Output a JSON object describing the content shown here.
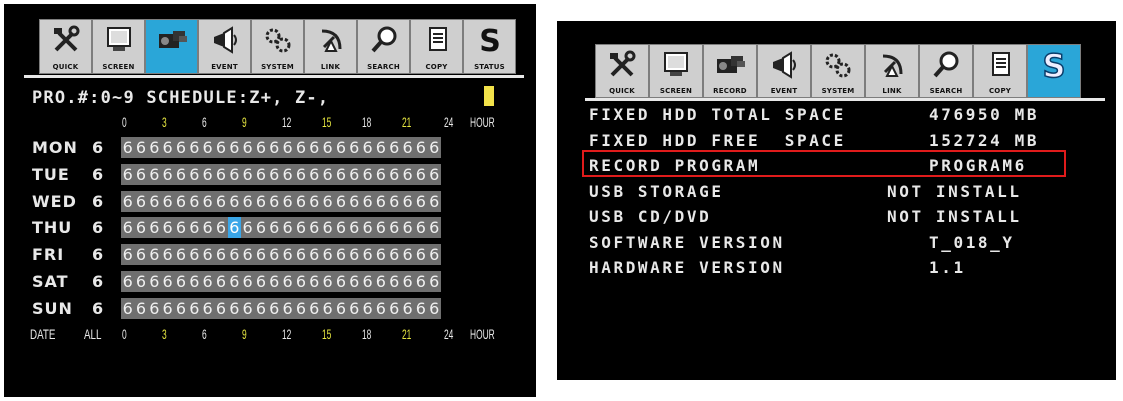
{
  "left": {
    "toolbar": [
      {
        "icon": "tools-icon",
        "label": "QUICK"
      },
      {
        "icon": "monitor-icon",
        "label": "SCREEN"
      },
      {
        "icon": "camera-icon",
        "label": ""
      },
      {
        "icon": "megaphone-icon",
        "label": "EVENT"
      },
      {
        "icon": "gears-icon",
        "label": "SYSTEM"
      },
      {
        "icon": "satellite-icon",
        "label": "LINK"
      },
      {
        "icon": "magnifier-icon",
        "label": "SEARCH"
      },
      {
        "icon": "document-icon",
        "label": "COPY"
      },
      {
        "icon": "status-s-icon",
        "label": "STATUS"
      }
    ],
    "active_tab": 2,
    "header": "PRO.#:0~9 SCHEDULE:Z+, Z-,",
    "hour_ticks": [
      "0",
      "3",
      "6",
      "9",
      "12",
      "15",
      "18",
      "21",
      "24"
    ],
    "hour_label": "HOUR",
    "days": [
      {
        "day": "MON",
        "program": "6",
        "cells": "666666666666666666666666"
      },
      {
        "day": "TUE",
        "program": "6",
        "cells": "666666666666666666666666"
      },
      {
        "day": "WED",
        "program": "6",
        "cells": "666666666666666666666666"
      },
      {
        "day": "THU",
        "program": "6",
        "cells": "666666666666666666666666"
      },
      {
        "day": "FRI",
        "program": "6",
        "cells": "666666666666666666666666"
      },
      {
        "day": "SAT",
        "program": "6",
        "cells": "666666666666666666666666"
      },
      {
        "day": "SUN",
        "program": "6",
        "cells": "666666666666666666666666"
      }
    ],
    "footer": {
      "date_label": "DATE",
      "all_label": "ALL"
    }
  },
  "right": {
    "toolbar": [
      {
        "icon": "tools-icon",
        "label": "QUICK"
      },
      {
        "icon": "monitor-icon",
        "label": "SCREEN"
      },
      {
        "icon": "camera-icon",
        "label": "RECORD"
      },
      {
        "icon": "megaphone-icon",
        "label": "EVENT"
      },
      {
        "icon": "gears-icon",
        "label": "SYSTEM"
      },
      {
        "icon": "satellite-icon",
        "label": "LINK"
      },
      {
        "icon": "magnifier-icon",
        "label": "SEARCH"
      },
      {
        "icon": "document-icon",
        "label": "COPY"
      },
      {
        "icon": "status-s-icon",
        "label": ""
      }
    ],
    "active_tab": 8,
    "rows": [
      {
        "label": "FIXED HDD TOTAL SPACE",
        "value": "476950 MB"
      },
      {
        "label": "FIXED HDD FREE  SPACE",
        "value": "152724 MB"
      },
      {
        "label": "RECORD PROGRAM",
        "value": "PROGRAM6"
      },
      {
        "label": "USB STORAGE",
        "value": "NOT INSTALL"
      },
      {
        "label": "USB CD/DVD",
        "value": "NOT INSTALL"
      },
      {
        "label": "SOFTWARE VERSION",
        "value": "T_018_Y"
      },
      {
        "label": "HARDWARE VERSION",
        "value": "1.1"
      }
    ],
    "highlighted_row": 2
  },
  "colors": {
    "active_tab": "#2aa6d8",
    "cell_bg": "#6f6f6f",
    "cursor": "#f2e24a",
    "highlight_border": "#e01b1b"
  }
}
